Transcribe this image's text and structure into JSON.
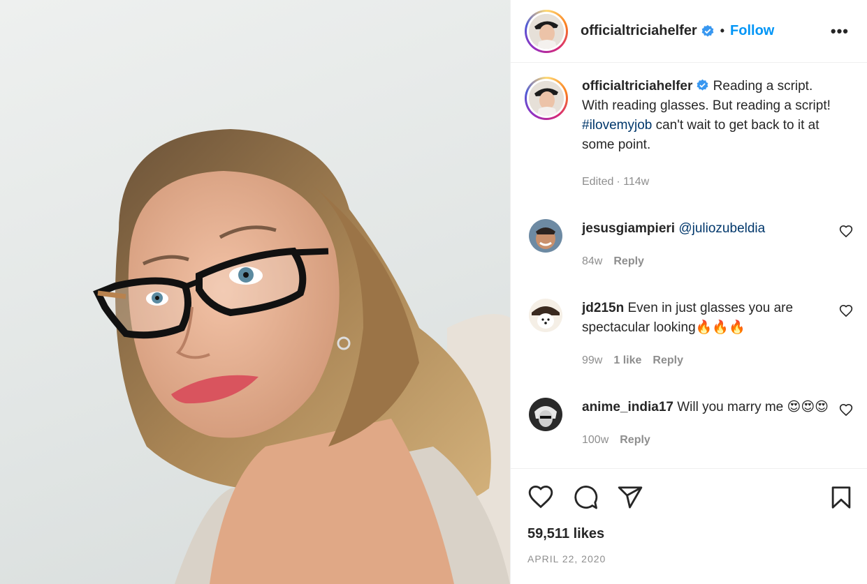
{
  "post": {
    "username": "officialtriciahelfer",
    "separator": "•",
    "follow_label": "Follow",
    "more_label": "•••",
    "photo_alt": "Selfie"
  },
  "caption": {
    "username": "officialtriciahelfer",
    "text_before": " Reading a script. With reading glasses. But reading a script! ",
    "hashtag": "#ilovemyjob",
    "text_after": " can't wait to get back to it at some point.",
    "edited": "Edited",
    "time": "· 114w"
  },
  "comments": [
    {
      "username": "jesusgiampieri",
      "text": "",
      "mention": "@juliozubeldia",
      "time": "84w",
      "likes": "",
      "reply": "Reply"
    },
    {
      "username": "jd215n",
      "text": " Even in just glasses you are spectacular looking🔥🔥🔥",
      "mention": "",
      "time": "99w",
      "likes": "1 like",
      "reply": "Reply"
    },
    {
      "username": "anime_india17",
      "text": " Will you marry me 😍😍😍",
      "mention": "",
      "time": "100w",
      "likes": "",
      "reply": "Reply"
    }
  ],
  "actions": {
    "likes": "59,511 likes",
    "date": "APRIL 22, 2020"
  },
  "colors": {
    "follow": "#0095f6",
    "hashtag": "#00376b",
    "verified": "#3897f0",
    "muted": "#8e8e8e"
  },
  "icons": [
    "verified-badge-icon",
    "more-options-icon",
    "heart-icon",
    "comment-icon",
    "share-icon",
    "bookmark-icon"
  ]
}
